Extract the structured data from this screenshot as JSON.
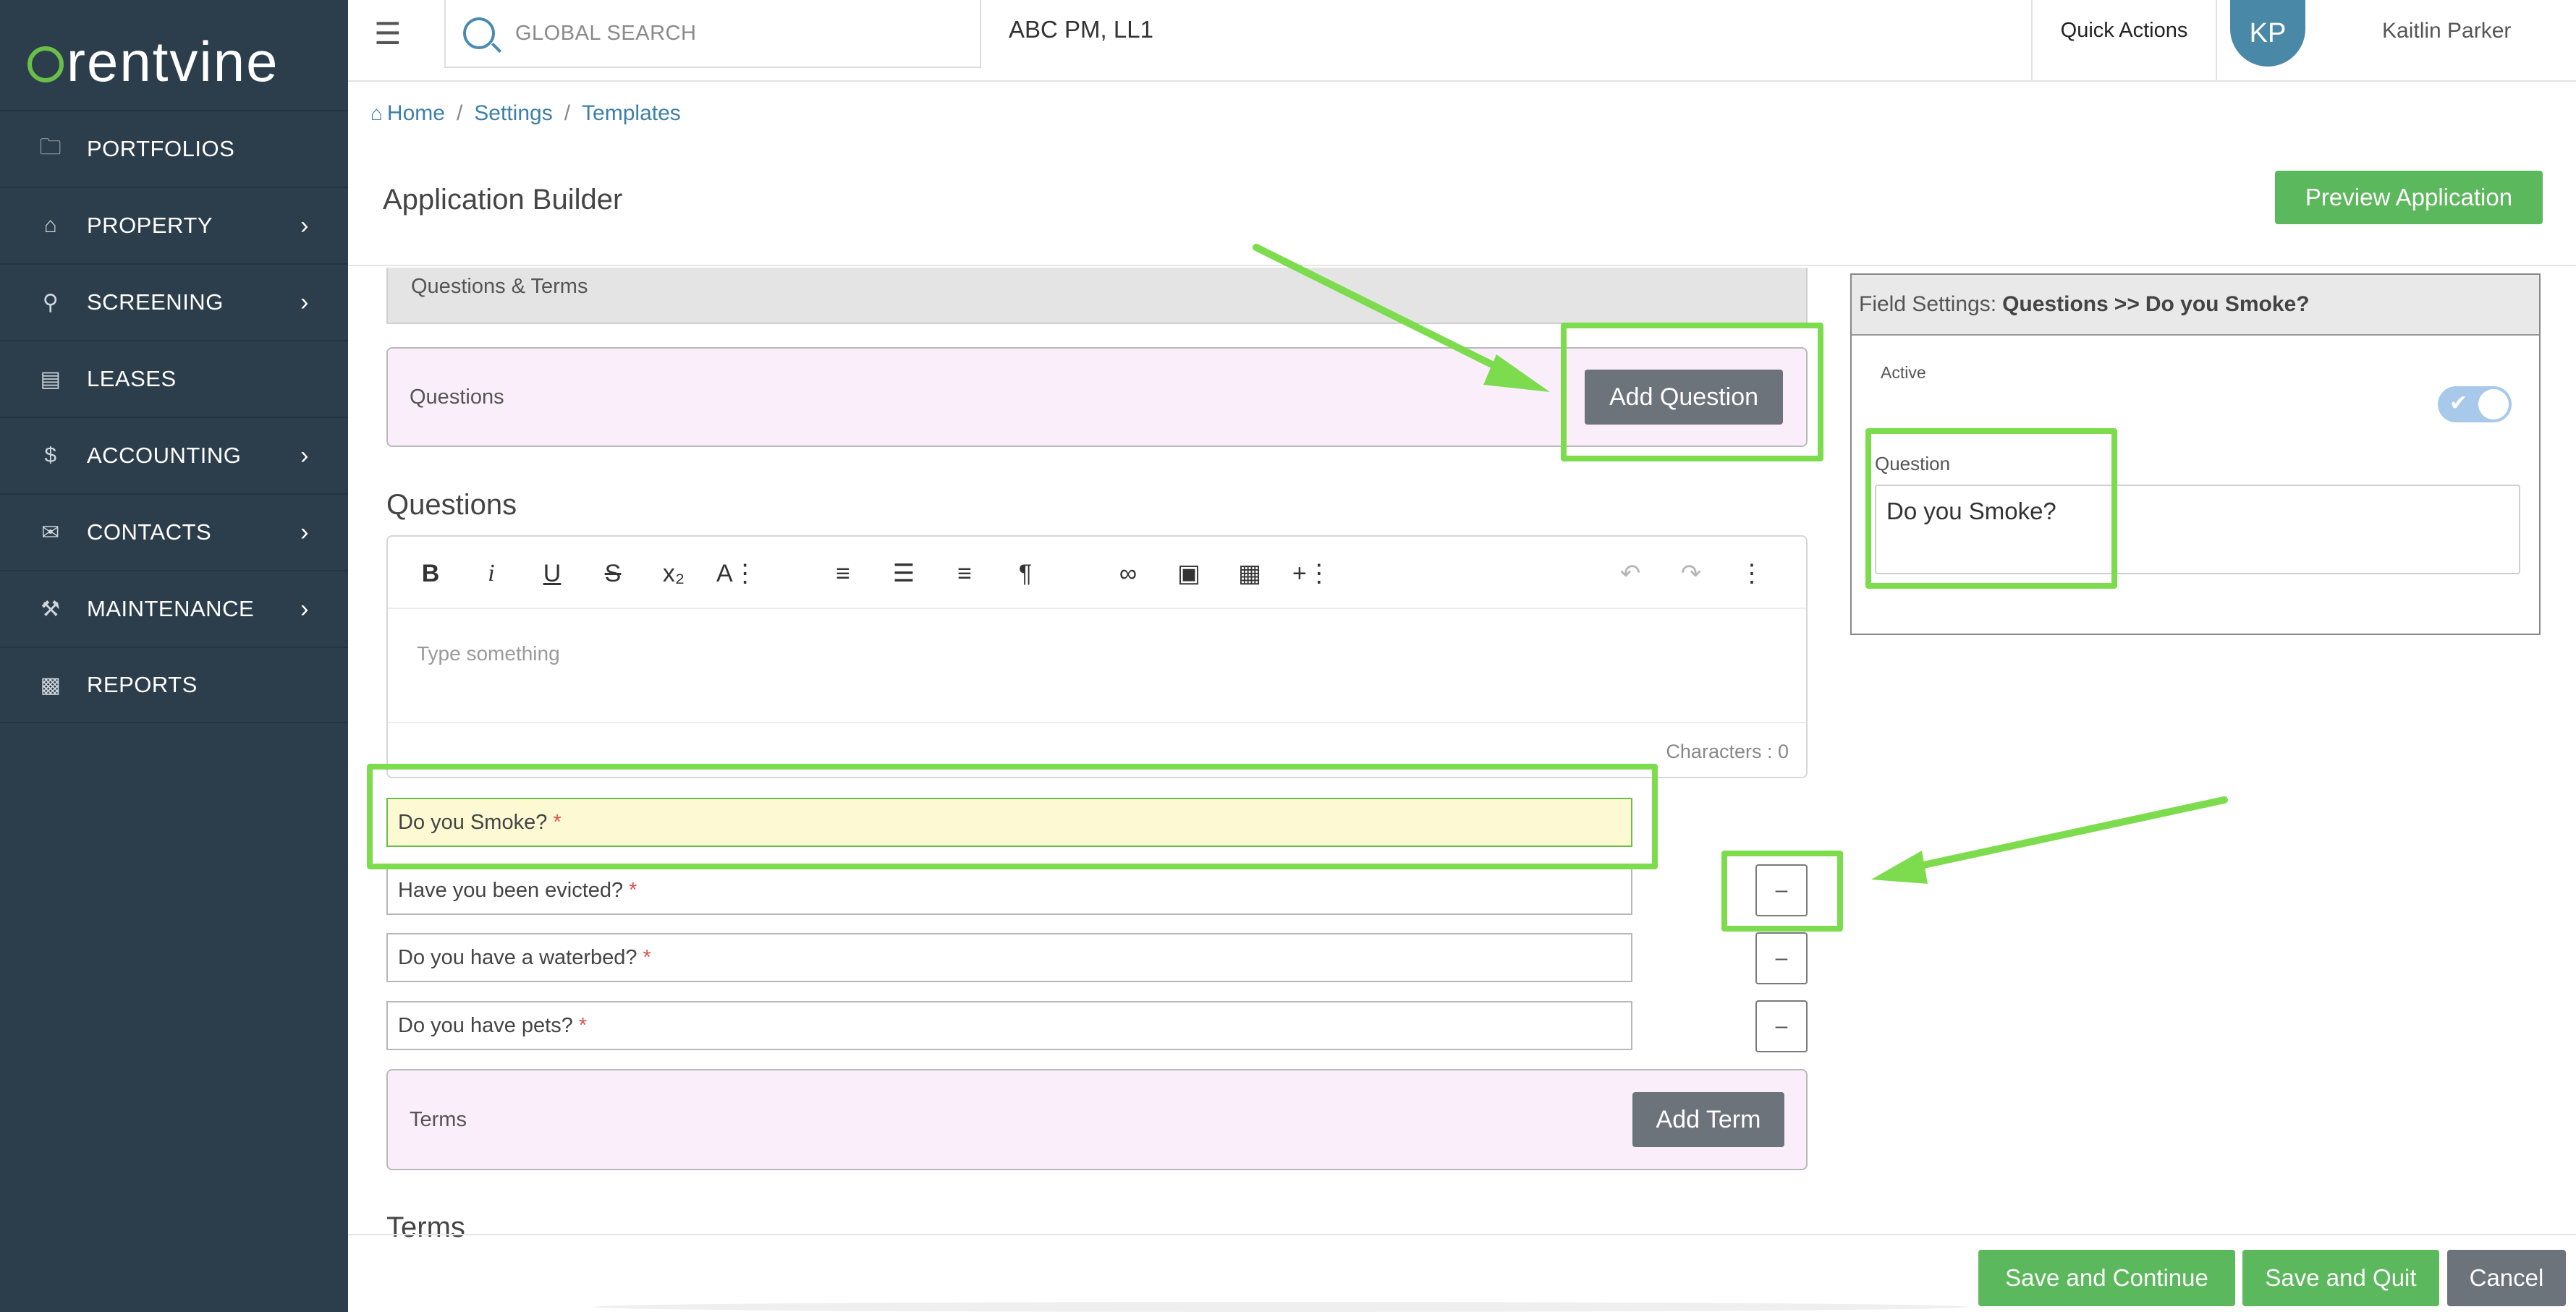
{
  "brand": {
    "logo_text": "rentvine"
  },
  "sidebar": {
    "items": [
      {
        "label": "PORTFOLIOS",
        "icon": "folder-icon",
        "has_submenu": false
      },
      {
        "label": "PROPERTY",
        "icon": "home-icon",
        "has_submenu": true
      },
      {
        "label": "SCREENING",
        "icon": "search-icon",
        "has_submenu": true
      },
      {
        "label": "LEASES",
        "icon": "document-icon",
        "has_submenu": false
      },
      {
        "label": "ACCOUNTING",
        "icon": "dollar-icon",
        "has_submenu": true
      },
      {
        "label": "CONTACTS",
        "icon": "chat-icon",
        "has_submenu": true
      },
      {
        "label": "MAINTENANCE",
        "icon": "wrench-icon",
        "has_submenu": true
      },
      {
        "label": "REPORTS",
        "icon": "chart-icon",
        "has_submenu": false
      }
    ]
  },
  "topbar": {
    "search_placeholder": "GLOBAL SEARCH",
    "company": "ABC PM, LL1",
    "quick_actions": "Quick Actions",
    "avatar_initials": "KP",
    "user_name": "Kaitlin Parker"
  },
  "breadcrumb": {
    "home": "Home",
    "settings": "Settings",
    "templates": "Templates",
    "separator": "/"
  },
  "header": {
    "title": "Application Builder",
    "preview_button": "Preview Application"
  },
  "builder": {
    "section_title": "Questions & Terms",
    "questions_panel_label": "Questions",
    "add_question_button": "Add Question",
    "questions_heading": "Questions",
    "editor": {
      "placeholder": "Type something",
      "char_count": "Characters : 0"
    },
    "questions": [
      {
        "text": "Do you Smoke?",
        "required": "*",
        "selected": true
      },
      {
        "text": "Have you been evicted?",
        "required": "*"
      },
      {
        "text": "Do you have a waterbed?",
        "required": "*"
      },
      {
        "text": "Do you have pets?",
        "required": "*"
      }
    ],
    "remove_label": "–",
    "terms_panel_label": "Terms",
    "add_term_button": "Add Term",
    "terms_heading": "Terms"
  },
  "field_settings": {
    "prefix": "Field Settings:",
    "section": "Questions",
    "arrow": ">>",
    "field": "Do you Smoke?",
    "active_label": "Active",
    "active": true,
    "question_label": "Question",
    "question_value": "Do you Smoke?"
  },
  "footer": {
    "save_continue": "Save and Continue",
    "save_quit": "Save and Quit",
    "cancel": "Cancel"
  },
  "colors": {
    "sidebar_bg": "#2c3e4c",
    "primary_green": "#5cb85c",
    "annotation_green": "#7ddc4e",
    "link_blue": "#3c7fa8",
    "highlight_yellow": "#fdfad3",
    "panel_pink": "#fbeefb"
  }
}
